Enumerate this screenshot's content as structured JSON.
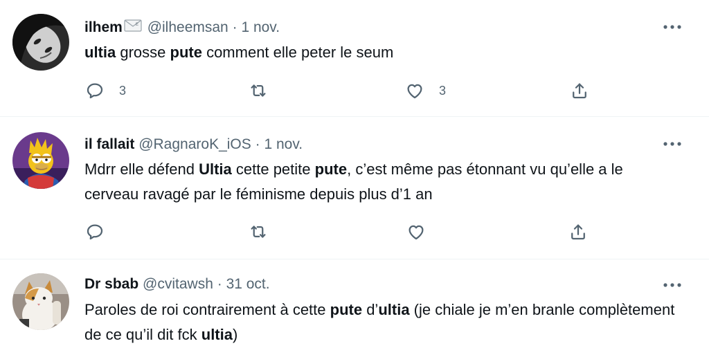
{
  "tweets": [
    {
      "display_name": "ilhem",
      "name_emoji": "envelope-icon",
      "handle": "@ilheemsan",
      "separator": "·",
      "date": "1 nov.",
      "text_segments": [
        {
          "t": "ultia",
          "b": true
        },
        {
          "t": " grosse ",
          "b": false
        },
        {
          "t": "pute",
          "b": true
        },
        {
          "t": " comment elle peter le seum",
          "b": false
        }
      ],
      "replies": "3",
      "retweets": "",
      "likes": "3"
    },
    {
      "display_name": "il fallait",
      "handle": "@RagnaroK_iOS",
      "separator": "·",
      "date": "1 nov.",
      "text_segments": [
        {
          "t": "Mdrr elle défend ",
          "b": false
        },
        {
          "t": "Ultia",
          "b": true
        },
        {
          "t": " cette petite ",
          "b": false
        },
        {
          "t": "pute",
          "b": true
        },
        {
          "t": ", c’est même pas étonnant vu qu’elle a le cerveau ravagé par le féminisme depuis plus d’1 an",
          "b": false
        }
      ],
      "replies": "",
      "retweets": "",
      "likes": ""
    },
    {
      "display_name": "Dr sbab",
      "handle": "@cvitawsh",
      "separator": "·",
      "date": "31 oct.",
      "text_segments": [
        {
          "t": "Paroles de roi contrairement à cette ",
          "b": false
        },
        {
          "t": "pute",
          "b": true
        },
        {
          "t": " d’",
          "b": false
        },
        {
          "t": "ultia",
          "b": true
        },
        {
          "t": " (je chiale je m’en branle complètement de ce qu’il dit fck ",
          "b": false
        },
        {
          "t": "ultia",
          "b": true
        },
        {
          "t": ")",
          "b": false
        }
      ]
    }
  ],
  "icons": {
    "more": "more-horizontal-icon",
    "reply": "reply-bubble-icon",
    "retweet": "retweet-icon",
    "like": "heart-icon",
    "share": "share-icon"
  },
  "colors": {
    "text": "#0f1419",
    "secondary": "#536471",
    "divider": "#eff3f4"
  }
}
